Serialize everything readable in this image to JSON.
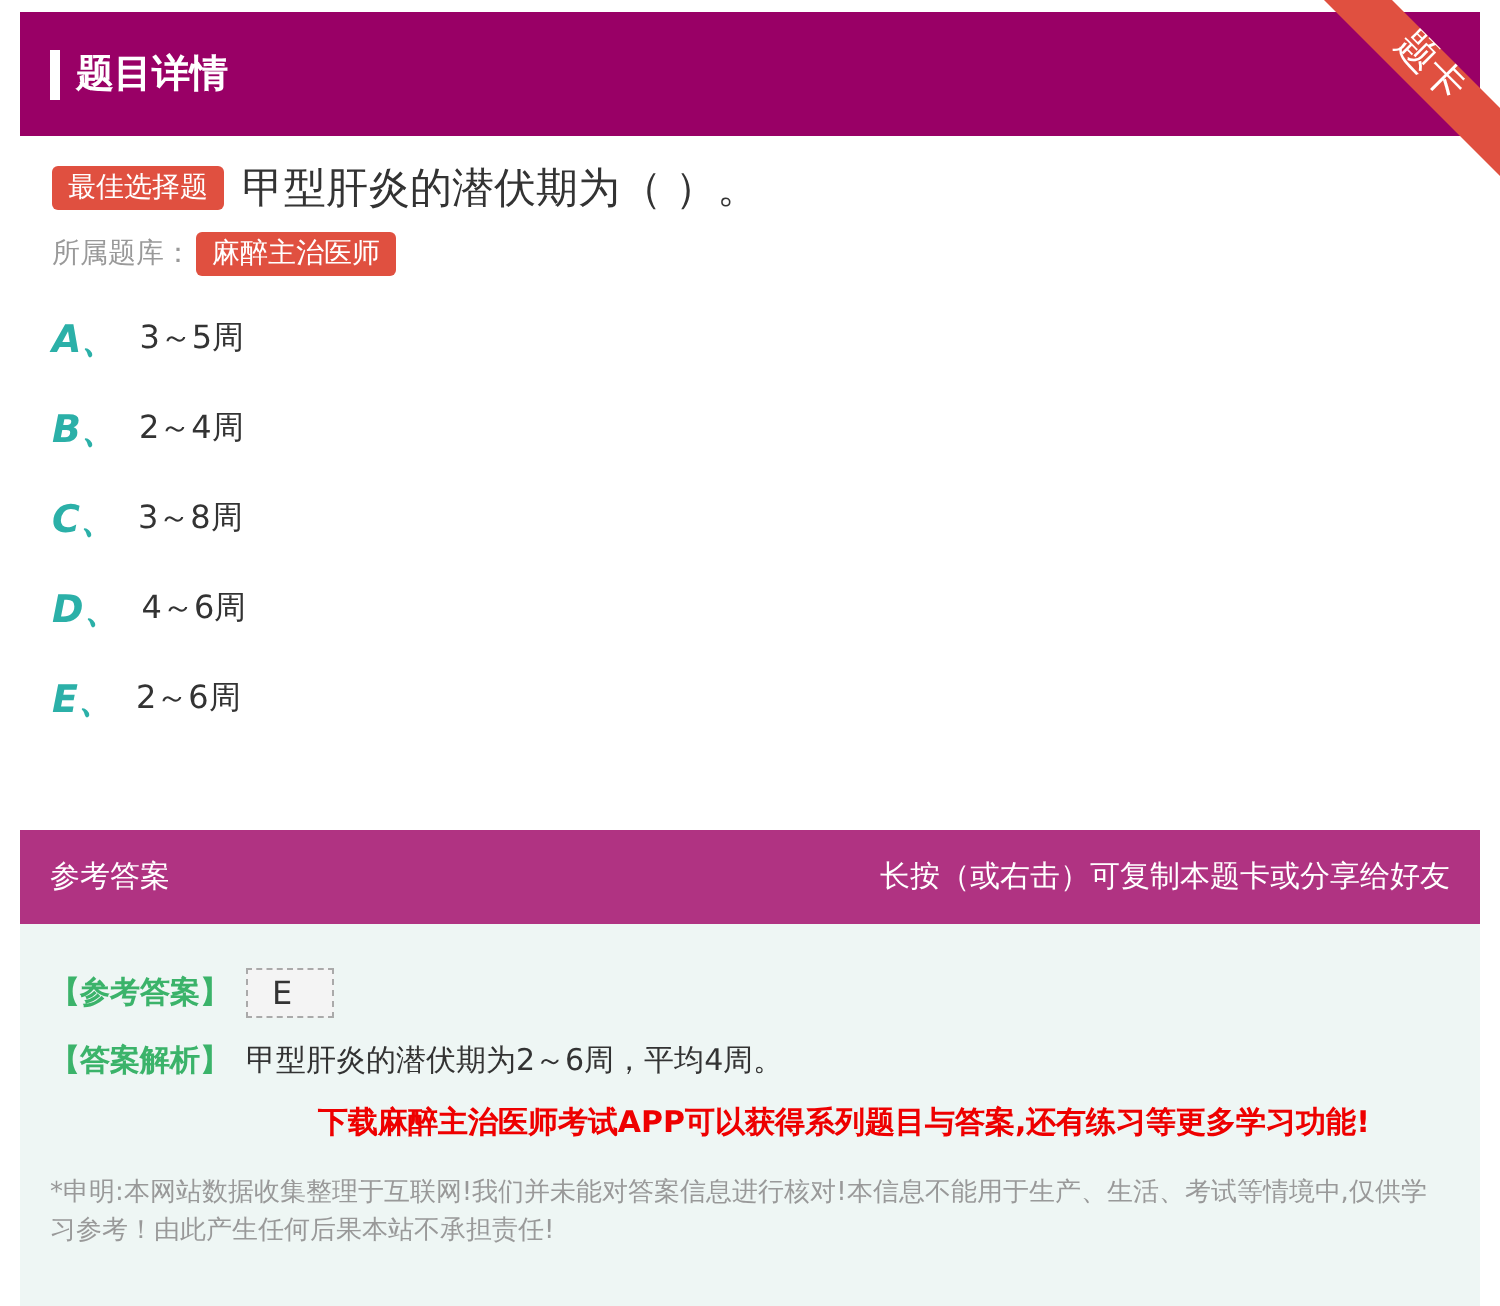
{
  "header": {
    "title": "题目详情",
    "corner_tag": "题卡"
  },
  "question": {
    "type_tag": "最佳选择题",
    "text": "甲型肝炎的潜伏期为（ ）。",
    "bank_label": "所属题库：",
    "bank_tag": "麻醉主治医师"
  },
  "options": [
    {
      "letter": "A、",
      "text": "3～5周"
    },
    {
      "letter": "B、",
      "text": "2～4周"
    },
    {
      "letter": "C、",
      "text": "3～8周"
    },
    {
      "letter": "D、",
      "text": "4～6周"
    },
    {
      "letter": "E、",
      "text": "2～6周"
    }
  ],
  "answer_panel": {
    "title": "参考答案",
    "hint": "长按（或右击）可复制本题卡或分享给好友",
    "answer_label": "【参考答案】",
    "answer": "E",
    "analysis_label": "【答案解析】",
    "analysis": "甲型肝炎的潜伏期为2～6周，平均4周。",
    "promo": "下载麻醉主治医师考试APP可以获得系列题目与答案,还有练习等更多学习功能!",
    "disclaimer": "*申明:本网站数据收集整理于互联网!我们并未能对答案信息进行核对!本信息不能用于生产、生活、考试等情境中,仅供学习参考！由此产生任何后果本站不承担责任!"
  }
}
